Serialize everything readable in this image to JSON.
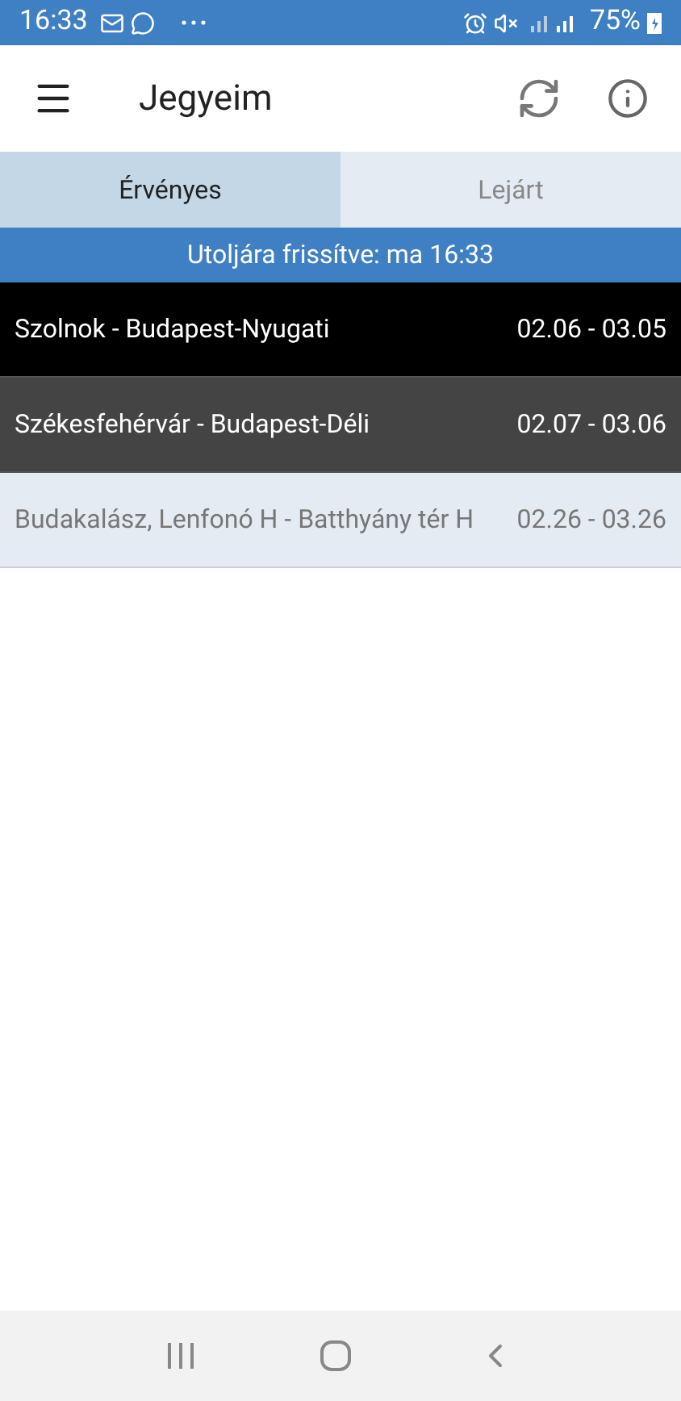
{
  "status_bar": {
    "time": "16:33",
    "battery": "75%"
  },
  "app_bar": {
    "title": "Jegyeim"
  },
  "tabs": [
    {
      "label": "Érvényes",
      "selected": true
    },
    {
      "label": "Lejárt",
      "selected": false
    }
  ],
  "refresh_banner": "Utoljára frissítve: ma 16:33",
  "tickets": [
    {
      "route": "Szolnok - Budapest-Nyugati",
      "dates": "02.06 - 03.05",
      "color": "#000000"
    },
    {
      "route": "Székesfehérvár - Budapest-Déli",
      "dates": "02.07 - 03.06",
      "color": "#444444"
    },
    {
      "route": "Budakalász, Lenfonó H - Batthyány tér H",
      "dates": "02.26 - 03.26",
      "color": "#e5ebf3"
    }
  ]
}
